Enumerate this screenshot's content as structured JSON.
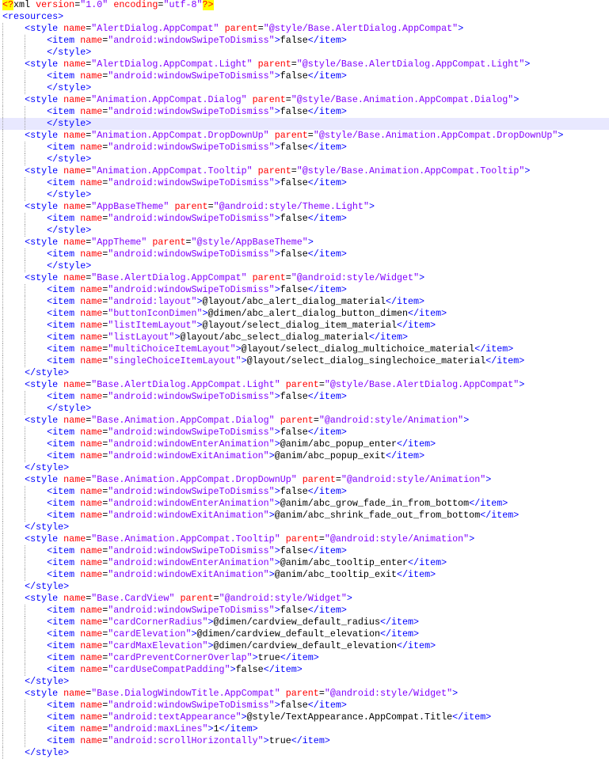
{
  "editor": {
    "highlighted_line": 11,
    "colors": {
      "tag": "#0000ff",
      "attribute": "#ff0000",
      "value": "#8000ff",
      "text": "#000000",
      "current_line": "#e8e8ff",
      "pi_background": "#ffff00"
    },
    "lines": [
      "<?xml version=\"1.0\" encoding=\"utf-8\"?>",
      "<resources>",
      "    <style name=\"AlertDialog.AppCompat\" parent=\"@style/Base.AlertDialog.AppCompat\">",
      "        <item name=\"android:windowSwipeToDismiss\">false</item>",
      "        </style>",
      "    <style name=\"AlertDialog.AppCompat.Light\" parent=\"@style/Base.AlertDialog.AppCompat.Light\">",
      "        <item name=\"android:windowSwipeToDismiss\">false</item>",
      "        </style>",
      "    <style name=\"Animation.AppCompat.Dialog\" parent=\"@style/Base.Animation.AppCompat.Dialog\">",
      "        <item name=\"android:windowSwipeToDismiss\">false</item>",
      "        </style>",
      "    <style name=\"Animation.AppCompat.DropDownUp\" parent=\"@style/Base.Animation.AppCompat.DropDownUp\">",
      "        <item name=\"android:windowSwipeToDismiss\">false</item>",
      "        </style>",
      "    <style name=\"Animation.AppCompat.Tooltip\" parent=\"@style/Base.Animation.AppCompat.Tooltip\">",
      "        <item name=\"android:windowSwipeToDismiss\">false</item>",
      "        </style>",
      "    <style name=\"AppBaseTheme\" parent=\"@android:style/Theme.Light\">",
      "        <item name=\"android:windowSwipeToDismiss\">false</item>",
      "        </style>",
      "    <style name=\"AppTheme\" parent=\"@style/AppBaseTheme\">",
      "        <item name=\"android:windowSwipeToDismiss\">false</item>",
      "        </style>",
      "    <style name=\"Base.AlertDialog.AppCompat\" parent=\"@android:style/Widget\">",
      "        <item name=\"android:windowSwipeToDismiss\">false</item>",
      "        <item name=\"android:layout\">@layout/abc_alert_dialog_material</item>",
      "        <item name=\"buttonIconDimen\">@dimen/abc_alert_dialog_button_dimen</item>",
      "        <item name=\"listItemLayout\">@layout/select_dialog_item_material</item>",
      "        <item name=\"listLayout\">@layout/abc_select_dialog_material</item>",
      "        <item name=\"multiChoiceItemLayout\">@layout/select_dialog_multichoice_material</item>",
      "        <item name=\"singleChoiceItemLayout\">@layout/select_dialog_singlechoice_material</item>",
      "    </style>",
      "    <style name=\"Base.AlertDialog.AppCompat.Light\" parent=\"@style/Base.AlertDialog.AppCompat\">",
      "        <item name=\"android:windowSwipeToDismiss\">false</item>",
      "        </style>",
      "    <style name=\"Base.Animation.AppCompat.Dialog\" parent=\"@android:style/Animation\">",
      "        <item name=\"android:windowSwipeToDismiss\">false</item>",
      "        <item name=\"android:windowEnterAnimation\">@anim/abc_popup_enter</item>",
      "        <item name=\"android:windowExitAnimation\">@anim/abc_popup_exit</item>",
      "    </style>",
      "    <style name=\"Base.Animation.AppCompat.DropDownUp\" parent=\"@android:style/Animation\">",
      "        <item name=\"android:windowSwipeToDismiss\">false</item>",
      "        <item name=\"android:windowEnterAnimation\">@anim/abc_grow_fade_in_from_bottom</item>",
      "        <item name=\"android:windowExitAnimation\">@anim/abc_shrink_fade_out_from_bottom</item>",
      "    </style>",
      "    <style name=\"Base.Animation.AppCompat.Tooltip\" parent=\"@android:style/Animation\">",
      "        <item name=\"android:windowSwipeToDismiss\">false</item>",
      "        <item name=\"android:windowEnterAnimation\">@anim/abc_tooltip_enter</item>",
      "        <item name=\"android:windowExitAnimation\">@anim/abc_tooltip_exit</item>",
      "    </style>",
      "    <style name=\"Base.CardView\" parent=\"@android:style/Widget\">",
      "        <item name=\"android:windowSwipeToDismiss\">false</item>",
      "        <item name=\"cardCornerRadius\">@dimen/cardview_default_radius</item>",
      "        <item name=\"cardElevation\">@dimen/cardview_default_elevation</item>",
      "        <item name=\"cardMaxElevation\">@dimen/cardview_default_elevation</item>",
      "        <item name=\"cardPreventCornerOverlap\">true</item>",
      "        <item name=\"cardUseCompatPadding\">false</item>",
      "    </style>",
      "    <style name=\"Base.DialogWindowTitle.AppCompat\" parent=\"@android:style/Widget\">",
      "        <item name=\"android:windowSwipeToDismiss\">false</item>",
      "        <item name=\"android:textAppearance\">@style/TextAppearance.AppCompat.Title</item>",
      "        <item name=\"android:maxLines\">1</item>",
      "        <item name=\"android:scrollHorizontally\">true</item>",
      "    </style>"
    ]
  }
}
